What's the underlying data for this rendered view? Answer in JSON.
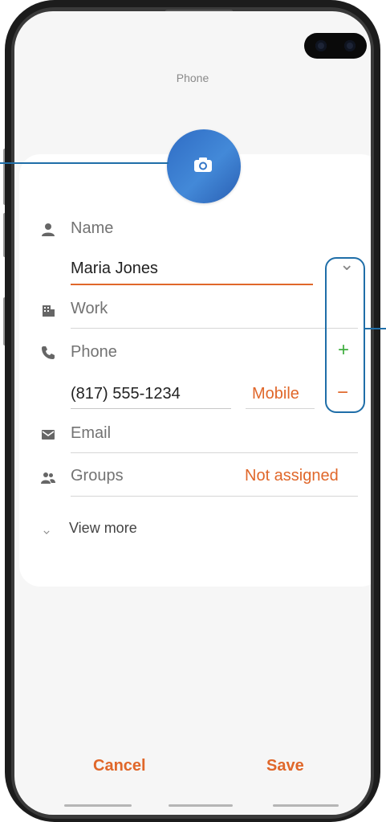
{
  "screen": {
    "title": "Phone"
  },
  "fields": {
    "name": {
      "label": "Name",
      "value": "Maria Jones"
    },
    "work": {
      "label": "Work"
    },
    "phone": {
      "label": "Phone",
      "value": "(817) 555-1234",
      "type": "Mobile"
    },
    "email": {
      "label": "Email"
    },
    "groups": {
      "label": "Groups",
      "value": "Not assigned"
    }
  },
  "view_more": "View more",
  "controls": {
    "expand": "⌄",
    "add": "+",
    "remove": "−"
  },
  "footer": {
    "cancel": "Cancel",
    "save": "Save"
  },
  "colors": {
    "accent": "#e0672a",
    "callout": "#1f6ea8",
    "add": "#3fae3f",
    "remove": "#e0672a",
    "photo": "#3577c8"
  },
  "icons": [
    "camera-icon",
    "person-icon",
    "building-icon",
    "phone-icon",
    "mail-icon",
    "group-icon",
    "chevron-down-icon"
  ]
}
